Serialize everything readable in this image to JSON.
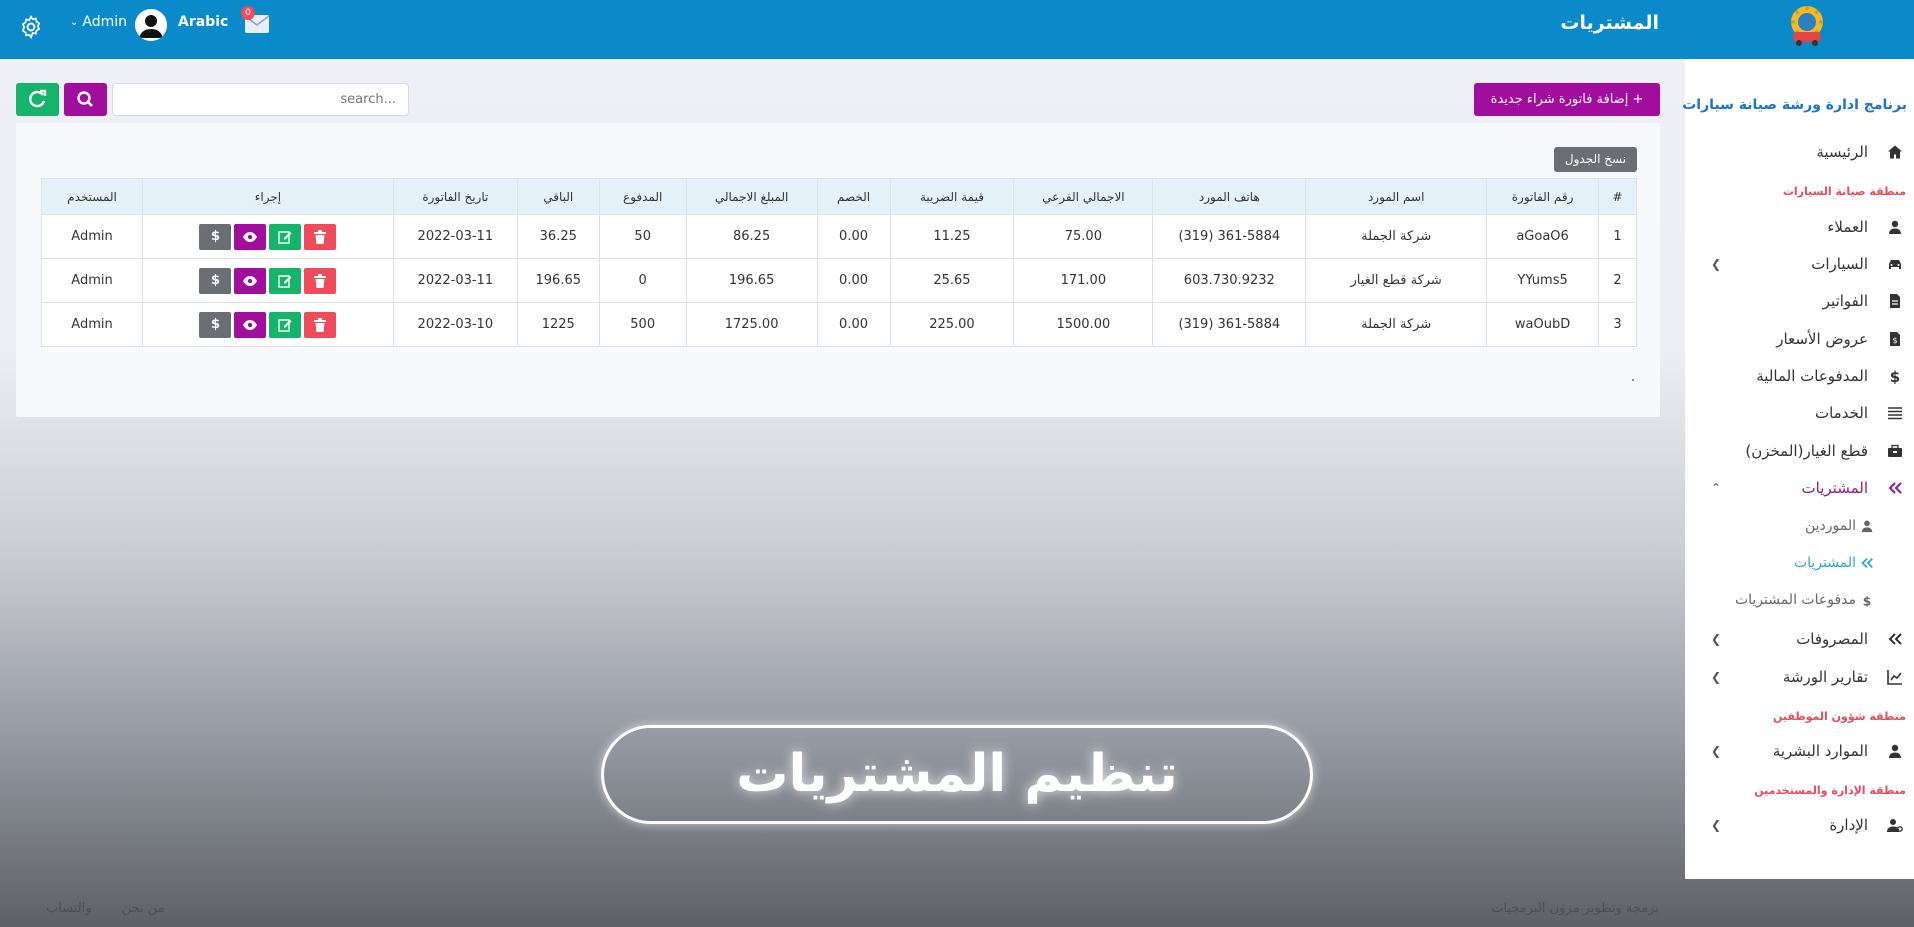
{
  "topbar": {
    "title": "المشتريات",
    "user": "Admin",
    "language": "Arabic",
    "mail_count": "0"
  },
  "sidebar": {
    "brand": "برنامج ادارة ورشة صيانة سيارات",
    "items": [
      {
        "label": "الرئيسية",
        "icon": "home-icon"
      },
      {
        "label": "العملاء",
        "icon": "user-icon"
      },
      {
        "label": "السيارات",
        "icon": "car-icon"
      },
      {
        "label": "الفواتير",
        "icon": "file-icon"
      },
      {
        "label": "عروض الأسعار",
        "icon": "file-dollar-icon"
      },
      {
        "label": "المدفوعات المالية",
        "icon": "dollar-icon"
      },
      {
        "label": "الخدمات",
        "icon": "list-icon"
      },
      {
        "label": "قطع الغيار(المخزن)",
        "icon": "toolbox-icon"
      },
      {
        "label": "المشتريات",
        "icon": "double-chevron-icon"
      },
      {
        "label": "المصروفات",
        "icon": "double-chevron-icon"
      },
      {
        "label": "تقارير الورشة",
        "icon": "chart-icon"
      },
      {
        "label": "الموارد البشرية",
        "icon": "user-icon"
      },
      {
        "label": "الإدارة",
        "icon": "user-gear-icon"
      }
    ],
    "sections": [
      "منطقة صيانة السيارات",
      "منطقة شؤون الموظفين",
      "منطقة الإدارة والمستخدمين"
    ],
    "subitems": [
      {
        "label": "الموردين",
        "icon": "user-icon"
      },
      {
        "label": "المشتريات",
        "icon": "double-chevron-icon"
      },
      {
        "label": "مدفوعات المشتريات",
        "icon": "dollar-icon"
      }
    ]
  },
  "toolbar": {
    "add_label": "+ إضافة فاتورة شراء جديدة",
    "search_placeholder": "search...",
    "copy_label": "نسخ الجدول"
  },
  "table": {
    "headers": [
      "#",
      "رقم الفاتورة",
      "اسم المورد",
      "هاتف المورد",
      "الاجمالي الفرعي",
      "قيمة الضريبة",
      "الخصم",
      "المبلغ الاجمالي",
      "المدفوع",
      "الباقي",
      "تاريخ الفاتورة",
      "إجراء",
      "المستخدم"
    ],
    "rows": [
      [
        "1",
        "aGoaO6",
        "شركة الجملة",
        "(319) 361-5884",
        "75.00",
        "11.25",
        "0.00",
        "86.25",
        "50",
        "36.25",
        "2022-03-11",
        "Admin"
      ],
      [
        "2",
        "YYums5",
        "شركة قطع الغيار",
        "603.730.9232",
        "171.00",
        "25.65",
        "0.00",
        "196.65",
        "0",
        "196.65",
        "2022-03-11",
        "Admin"
      ],
      [
        "3",
        "waOubD",
        "شركة الجملة",
        "(319) 361-5884",
        "1500.00",
        "225.00",
        "0.00",
        "1725.00",
        "500",
        "1225",
        "2022-03-10",
        "Admin"
      ]
    ],
    "pay_symbol": "$"
  },
  "caption": "تنظيم المشتريات",
  "footer": {
    "left_links": [
      "من نحن",
      "والتساب"
    ],
    "right_text": "برمجة وتطوير مزون البرمجيات"
  },
  "colors": {
    "topbar": "#0b8ac9",
    "primary_purple": "#a10e9e",
    "success_green": "#16b36a",
    "danger_red": "#ef4b5b",
    "secondary_gray": "#6b6f74",
    "section_red": "#e74c5c",
    "brand_blue": "#1a73c8"
  }
}
